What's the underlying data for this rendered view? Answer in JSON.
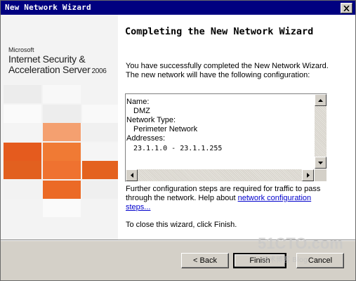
{
  "window": {
    "title": "New Network Wizard",
    "close_icon": "close-x-icon"
  },
  "branding": {
    "company": "Microsoft",
    "product_line1": "Internet Security &",
    "product_line2": "Acceleration Server",
    "year": "2006",
    "accent_orange": "#e8651f",
    "accent_light": "#f4a070"
  },
  "main": {
    "heading": "Completing the New Network Wizard",
    "intro_line1": "You have successfully completed the New Network Wizard.",
    "intro_line2": "The new network will have the following configuration:",
    "config": {
      "name_label": "Name:",
      "name_value": "DMZ",
      "type_label": "Network Type:",
      "type_value": "Perimeter Network",
      "addresses_label": "Addresses:",
      "addresses_value": "23.1.1.0 - 23.1.1.255"
    },
    "further_line1": "Further configuration steps are required for traffic to pass",
    "further_line2_prefix": "through the network. Help about ",
    "further_link_part1": "network configuration",
    "further_link_part2": "steps...",
    "close_instruction": "To close this wizard, click Finish."
  },
  "buttons": {
    "back_label": "< Back",
    "finish_label": "Finish",
    "cancel_label": "Cancel"
  },
  "watermark": {
    "site": "51CTO.com",
    "sub": "技术博客 Blog"
  }
}
